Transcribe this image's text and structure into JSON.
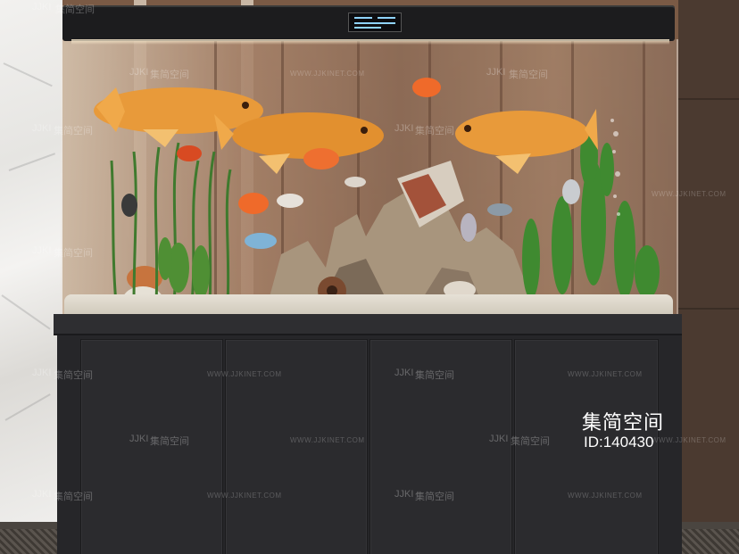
{
  "watermarks": {
    "logo": "JJKI",
    "brand_cn": "集简空间",
    "site": "WWW.JJKINET.COM"
  },
  "brand": {
    "title": "集简空间",
    "id_text": "ID:140430"
  },
  "colors": {
    "cabinet": "#262629",
    "lid": "#1c1c1e",
    "arowana": "#e89a3a",
    "wood_panel": "#7a5a45"
  }
}
